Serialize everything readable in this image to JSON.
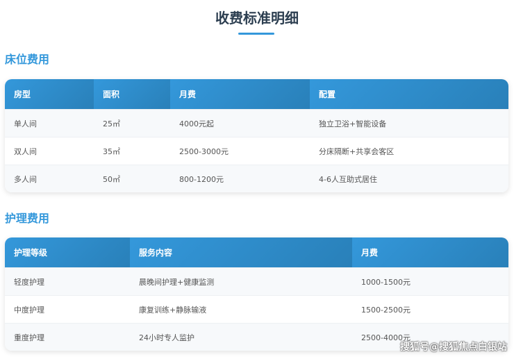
{
  "title": "收费标准明细",
  "bed": {
    "heading": "床位费用",
    "headers": [
      "房型",
      "面积",
      "月费",
      "配置"
    ],
    "rows": [
      [
        "单人间",
        "25㎡",
        "4000元起",
        "独立卫浴+智能设备"
      ],
      [
        "双人间",
        "35㎡",
        "2500-3000元",
        "分床隔断+共享会客区"
      ],
      [
        "多人间",
        "50㎡",
        "800-1200元",
        "4-6人互助式居住"
      ]
    ]
  },
  "care": {
    "heading": "护理费用",
    "headers": [
      "护理等级",
      "服务内容",
      "月费"
    ],
    "rows": [
      [
        "轻度护理",
        "晨晚间护理+健康监测",
        "1000-1500元"
      ],
      [
        "中度护理",
        "康复训练+静脉输液",
        "1500-2500元"
      ],
      [
        "重度护理",
        "24小时专人监护",
        "2500-4000元"
      ]
    ]
  },
  "watermark": "搜狐号@搜狐焦点白银站"
}
